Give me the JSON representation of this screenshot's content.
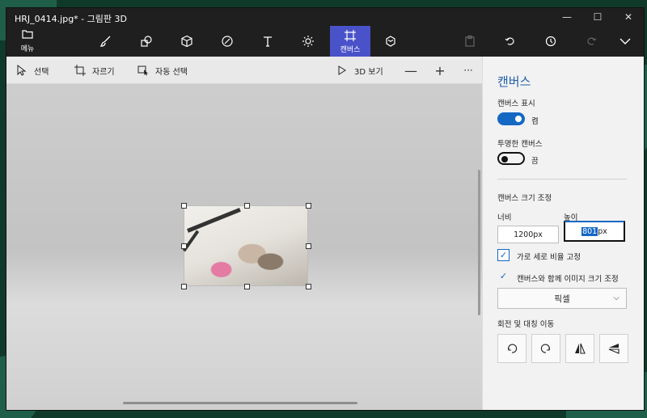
{
  "window": {
    "title": "HRJ_0414.jpg* - 그림판 3D",
    "minimize": "—",
    "maximize": "☐",
    "close": "✕"
  },
  "toolbar": {
    "menu_label": "메뉴",
    "active_tool_label": "캔버스",
    "tools": [
      "brushes-icon",
      "2d-shapes-icon",
      "3d-shapes-icon",
      "stickers-icon",
      "text-icon",
      "effects-icon",
      "canvas-icon",
      "3d-library-icon",
      "paste-icon",
      "undo-icon",
      "history-icon",
      "redo-icon",
      "expand-chevron-icon"
    ]
  },
  "subbar": {
    "select_label": "선택",
    "crop_label": "자르기",
    "magic_select_label": "자동 선택",
    "view3d_label": "3D 보기",
    "zoom_out": "—",
    "zoom_in": "+",
    "more": "···"
  },
  "panel": {
    "title": "캔버스",
    "show_canvas_label": "캔버스 표시",
    "show_canvas_state": "켬",
    "transparent_canvas_label": "투명한 캔버스",
    "transparent_canvas_state": "끔",
    "resize_label": "캔버스 크기 조정",
    "width_label": "너비",
    "height_label": "높이",
    "width_value": "1200",
    "height_value": "801",
    "unit": "px",
    "lock_aspect_label": "가로 세로 비율 고정",
    "resize_image_label": "캔버스와 함께 이미지 크기 조정",
    "unit_select_value": "픽셀",
    "rotate_flip_label": "회전 및 대칭 이동"
  },
  "colors": {
    "accent": "#1468c4",
    "active_tool": "#4a52c9",
    "title_color": "#1f5fa8"
  }
}
